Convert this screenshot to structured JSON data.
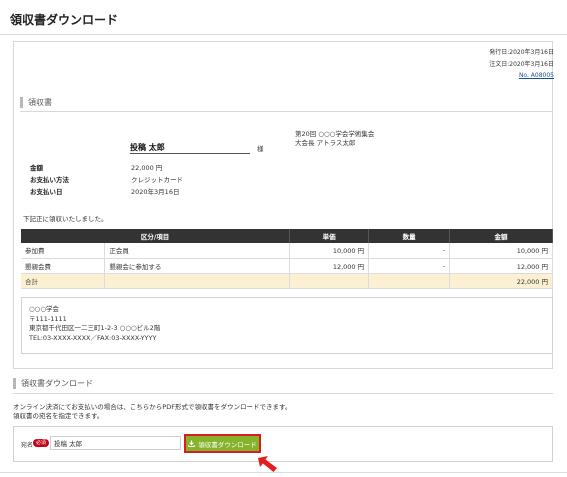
{
  "page": {
    "title": "領収書ダウンロード"
  },
  "meta": {
    "issue_date": "発行日:2020年3月16日",
    "order_date": "注文日:2020年3月16日",
    "order_no": "No. A08005"
  },
  "receipt": {
    "heading": "領収書",
    "recipient_name": "投稿 太郎",
    "honorific": "様",
    "org_line1": "第20回 ○○○学会学術集会",
    "org_line2": "大会長 アトラス太郎",
    "details": [
      {
        "label": "金額",
        "value": "22,000 円"
      },
      {
        "label": "お支払い方法",
        "value": "クレジットカード"
      },
      {
        "label": "お支払い日",
        "value": "2020年3月16日"
      }
    ],
    "received_text": "下記正に領収いたしました。",
    "table": {
      "headers": [
        "区分/項目",
        "単価",
        "数量",
        "金額"
      ],
      "rows": [
        {
          "category": "参加費",
          "item": "正会員",
          "unit_price": "10,000 円",
          "qty": "-",
          "amount": "10,000 円"
        },
        {
          "category": "懇親会費",
          "item": "懇親会に参加する",
          "unit_price": "12,000 円",
          "qty": "-",
          "amount": "12,000 円"
        }
      ],
      "total_label": "合計",
      "total_amount": "22,000 円"
    },
    "issuer": {
      "line1": "○○○学会",
      "line2": "〒111-1111",
      "line3": "東京都千代田区一二三町1-2-3 ○○○ビル2階",
      "line4": "TEL:03-XXXX-XXXX／FAX:03-XXXX-YYYY"
    }
  },
  "download": {
    "heading": "領収書ダウンロード",
    "desc_line1": "オンライン決済にてお支払いの場合は、こちらからPDF形式で領収書をダウンロードできます。",
    "desc_line2": "領収書の宛名を指定できます。",
    "field_label": "宛名",
    "required_badge": "必須",
    "name_value": "投稿 太郎",
    "button_label": "領収書ダウンロード",
    "button_icon": "download-icon"
  },
  "colors": {
    "header_bg": "#333333",
    "total_bg": "#fbf1d2",
    "button_bg": "#86b32b",
    "highlight": "#d42020",
    "badge": "#c4001a",
    "link": "#1a4fa0"
  }
}
